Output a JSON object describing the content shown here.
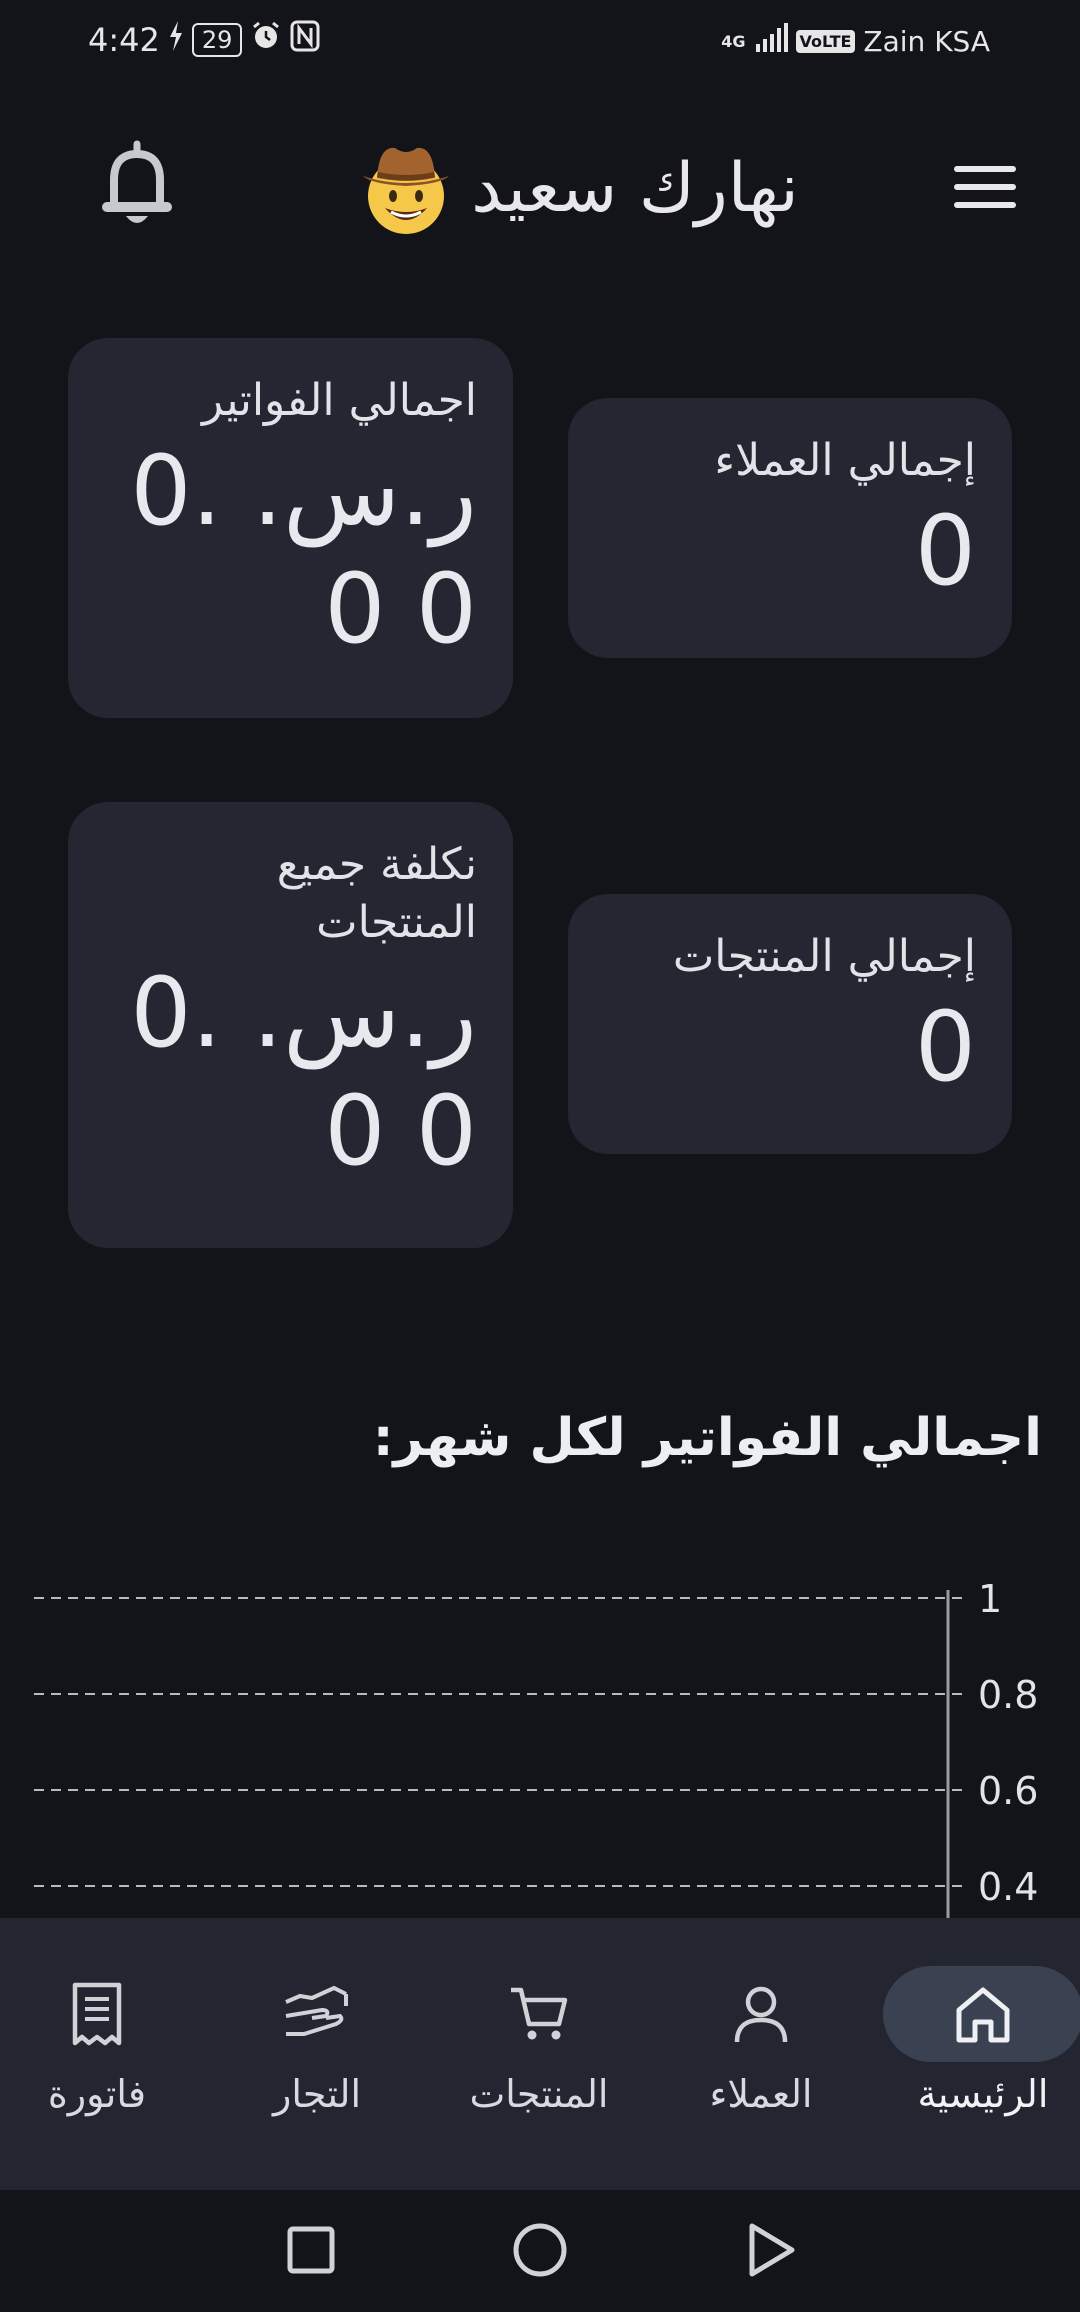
{
  "status_bar": {
    "time": "4:42",
    "battery": "29",
    "network_type": "4G",
    "volte": "VoLTE",
    "carrier": "Zain KSA"
  },
  "header": {
    "greeting": "نهارك سعيد",
    "emoji": "cowboy-face-emoji",
    "menu_icon": "hamburger-menu-icon",
    "bell_icon": "bell-icon"
  },
  "cards": {
    "total_customers": {
      "title": "إجمالي العملاء",
      "value": "0"
    },
    "total_invoices": {
      "title": "اجمالي الفواتير",
      "value": "ر.س. 0.0 0"
    },
    "total_products": {
      "title": "إجمالي المنتجات",
      "value": "0"
    },
    "products_cost": {
      "title": "نكلفة جميع المنتجات",
      "value": "ر.س. 0.0 0"
    }
  },
  "chart_data": {
    "type": "line",
    "title": "اجمالي الفواتير لكل شهر:",
    "xlabel": "",
    "ylabel": "",
    "ylim": [
      0,
      1
    ],
    "y_ticks": [
      "1",
      "0.8",
      "0.6",
      "0.4"
    ],
    "grid": true,
    "series": []
  },
  "bottom_nav": {
    "items": [
      {
        "label": "الرئيسية",
        "icon": "home-icon",
        "active": true
      },
      {
        "label": "العملاء",
        "icon": "person-icon",
        "active": false
      },
      {
        "label": "المنتجات",
        "icon": "cart-icon",
        "active": false
      },
      {
        "label": "التجار",
        "icon": "handshake-icon",
        "active": false
      },
      {
        "label": "فاتورة",
        "icon": "receipt-icon",
        "active": false
      }
    ]
  },
  "system_nav": {
    "recents_icon": "square-icon",
    "home_icon": "circle-icon",
    "back_icon": "triangle-back-icon"
  },
  "colors": {
    "background": "#121419",
    "card": "#242731",
    "nav_bar": "#232631",
    "active_pill": "#3a4150",
    "text": "#e4e5ea"
  }
}
